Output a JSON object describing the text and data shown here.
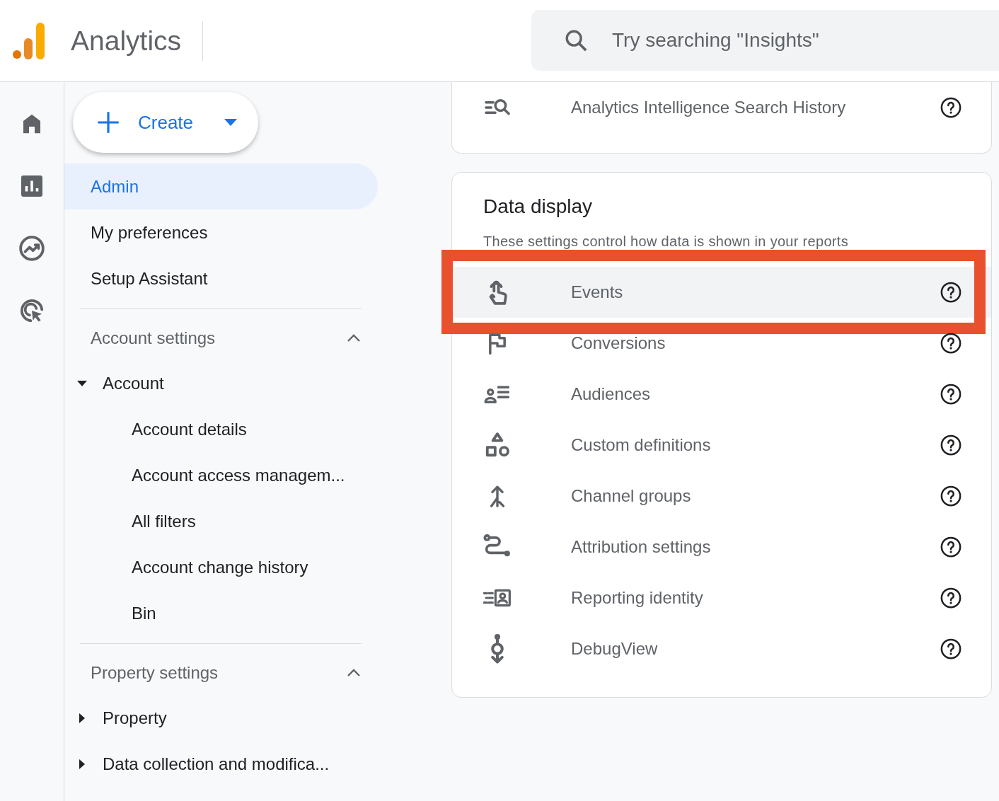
{
  "header": {
    "product": "Analytics",
    "search": {
      "placeholder": "Try searching \"Insights\""
    }
  },
  "rail": [
    {
      "kind": "home",
      "selected": false
    },
    {
      "kind": "reports",
      "selected": false
    },
    {
      "kind": "explore",
      "selected": false
    },
    {
      "kind": "advertising",
      "selected": false
    }
  ],
  "sidebar": {
    "create_button": "Create",
    "items": [
      {
        "label": "Admin",
        "selected": true
      },
      {
        "label": "My preferences",
        "selected": false
      },
      {
        "label": "Setup Assistant",
        "selected": false
      }
    ],
    "sections": [
      {
        "title": "Account settings",
        "expanded": true,
        "groups": [
          {
            "label": "Account",
            "expanded": true,
            "children": [
              {
                "label": "Account details"
              },
              {
                "label": "Account access managem..."
              },
              {
                "label": "All filters"
              },
              {
                "label": "Account change history"
              },
              {
                "label": "Bin"
              }
            ]
          }
        ]
      },
      {
        "title": "Property settings",
        "expanded": true,
        "groups": [
          {
            "label": "Property",
            "expanded": false
          },
          {
            "label": "Data collection and modifica...",
            "expanded": false
          }
        ]
      }
    ]
  },
  "cards": [
    {
      "rows": [
        {
          "label": "Analytics Intelligence Search History",
          "highlighted": false
        }
      ]
    },
    {
      "title": "Data display",
      "subtitle": "These settings control how data is shown in your reports",
      "rows": [
        {
          "label": "Events",
          "highlighted": true
        },
        {
          "label": "Conversions",
          "highlighted": false
        },
        {
          "label": "Audiences",
          "highlighted": false
        },
        {
          "label": "Custom definitions",
          "highlighted": false
        },
        {
          "label": "Channel groups",
          "highlighted": false
        },
        {
          "label": "Attribution settings",
          "highlighted": false
        },
        {
          "label": "Reporting identity",
          "highlighted": false
        },
        {
          "label": "DebugView",
          "highlighted": false
        }
      ]
    }
  ]
}
